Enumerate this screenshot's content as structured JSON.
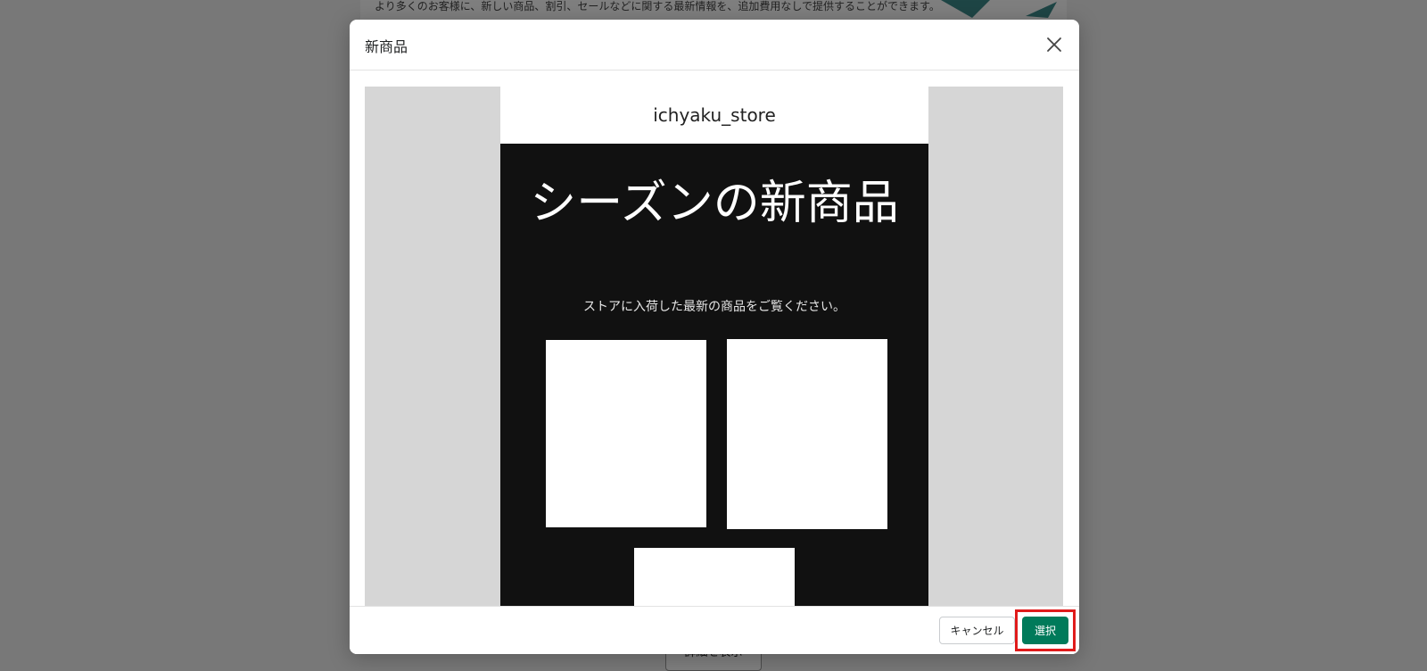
{
  "background": {
    "card_text": "より多くのお客様に、新しい商品、割引、セールなどに関する最新情報を、追加費用なしで提供することができます。",
    "details_button_label": "詳細を表示"
  },
  "modal": {
    "title": "新商品",
    "close_icon": "close-icon",
    "preview": {
      "store_name": "ichyaku_store",
      "headline": "シーズンの新商品",
      "subtext": "ストアに入荷した最新の商品をご覧ください。"
    },
    "footer": {
      "cancel_label": "キャンセル",
      "select_label": "選択"
    }
  },
  "colors": {
    "primary_button": "#007a5a",
    "highlight": "#e01b1b",
    "email_background": "#111111"
  }
}
